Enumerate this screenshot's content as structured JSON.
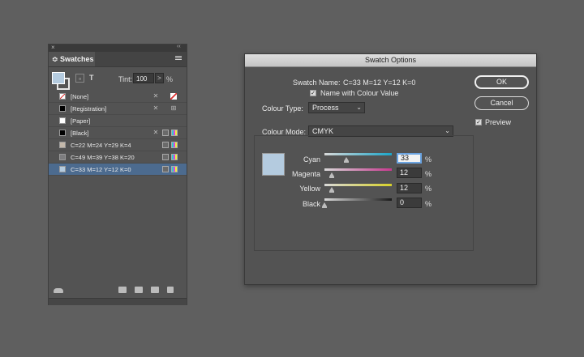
{
  "swatches_panel": {
    "close_glyph": "×",
    "collapse_glyph": "‹‹",
    "tab_label": "≎ Swatches",
    "text_icon_label": "T",
    "tint_label": "Tint:",
    "tint_value": "100",
    "tint_arrow": ">",
    "tint_unit": "%",
    "items": [
      {
        "name": "[None]",
        "chip": "none"
      },
      {
        "name": "[Registration]",
        "chip": "#000000"
      },
      {
        "name": "[Paper]",
        "chip": "#ffffff"
      },
      {
        "name": "[Black]",
        "chip": "#000000"
      },
      {
        "name": "C=22 M=24 Y=29 K=4",
        "chip": "#c4b9ab"
      },
      {
        "name": "C=49 M=39 Y=38 K=20",
        "chip": "#7d7d7f"
      },
      {
        "name": "C=33 M=12 Y=12 K=0",
        "chip": "#b4cbdf",
        "selected": true
      }
    ]
  },
  "dialog": {
    "title": "Swatch Options",
    "swatch_name_label": "Swatch Name:",
    "swatch_name_value": "C=33 M=12 Y=12 K=0",
    "name_with_value_label": "Name with Colour Value",
    "colour_type_label": "Colour Type:",
    "colour_type_value": "Process",
    "colour_mode_label": "Colour Mode:",
    "colour_mode_value": "CMYK",
    "ok_label": "OK",
    "cancel_label": "Cancel",
    "preview_label": "Preview",
    "check_glyph": "✓",
    "chevron": "⌄",
    "sliders": [
      {
        "label": "Cyan",
        "value": "33",
        "unit": "%"
      },
      {
        "label": "Magenta",
        "value": "12",
        "unit": "%"
      },
      {
        "label": "Yellow",
        "value": "12",
        "unit": "%"
      },
      {
        "label": "Black",
        "value": "0",
        "unit": "%"
      }
    ]
  },
  "colors": {
    "swatch_preview": "#b4cbdf",
    "selection": "#4c6b8f",
    "background": "#5f5f5f"
  }
}
